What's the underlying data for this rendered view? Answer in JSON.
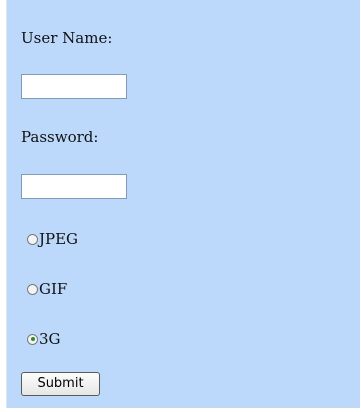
{
  "form": {
    "username_label": "User Name:",
    "username_value": "",
    "password_label": "Password:",
    "password_value": "",
    "format_options": [
      {
        "label": "JPEG",
        "checked": false
      },
      {
        "label": "GIF",
        "checked": false
      },
      {
        "label": "3G",
        "checked": true
      }
    ],
    "submit_label": "Submit"
  },
  "colors": {
    "panel_background": "#bcd9fb",
    "page_background": "#ffffff"
  }
}
